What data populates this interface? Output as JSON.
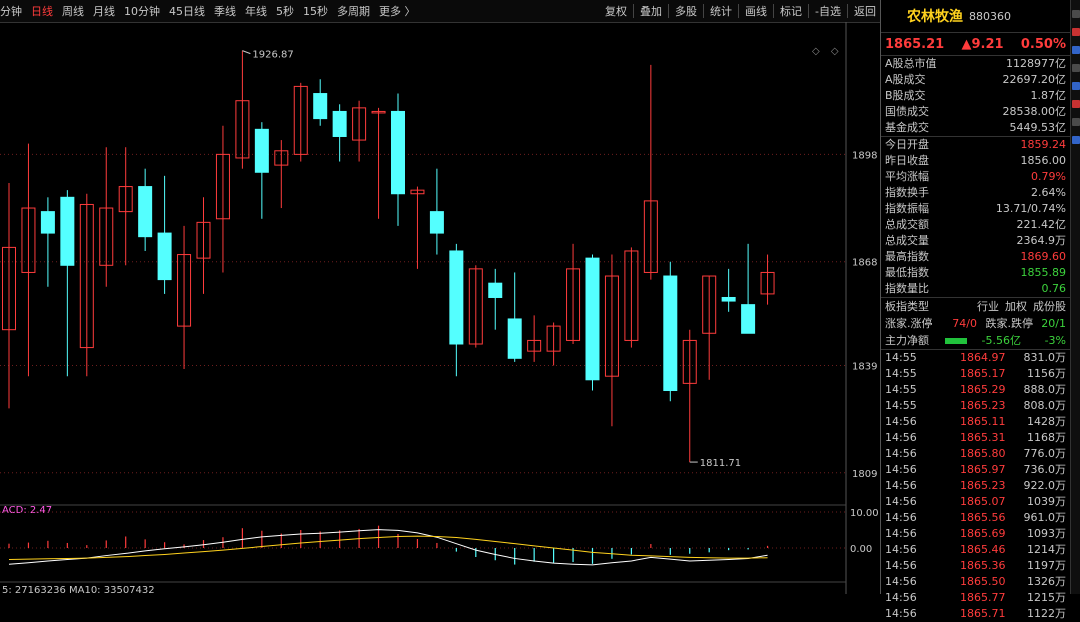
{
  "toolbar": {
    "periods": [
      "分钟",
      "日线",
      "周线",
      "月线",
      "10分钟",
      "45日线",
      "季线",
      "年线",
      "5秒",
      "15秒",
      "多周期",
      "更多 〉"
    ],
    "active": "日线",
    "actions": [
      "复权",
      "叠加",
      "多股",
      "统计",
      "画线",
      "标记",
      "-自选",
      "返回"
    ]
  },
  "chart": {
    "y_labels": [
      "1898",
      "1868",
      "1839",
      "1809"
    ],
    "high_label": "1926.87",
    "low_label": "1811.71",
    "macd_label": "ACD: 2.47",
    "macd_y_labels": [
      "10.00",
      "0.00"
    ],
    "volume_label": "5: 27163236  MA10: 33507432",
    "colors": {
      "up": "#ff3c3c",
      "down": "#54ffff",
      "grid": "#6e1e1e"
    }
  },
  "chart_data": {
    "type": "candlestick",
    "ylim": [
      1800,
      1935
    ],
    "candles": [
      {
        "o": 1849,
        "c": 1872,
        "h": 1890,
        "l": 1827
      },
      {
        "o": 1865,
        "c": 1883,
        "h": 1901,
        "l": 1836
      },
      {
        "o": 1882,
        "c": 1876,
        "h": 1886,
        "l": 1861
      },
      {
        "o": 1886,
        "c": 1867,
        "h": 1888,
        "l": 1836
      },
      {
        "o": 1844,
        "c": 1884,
        "h": 1887,
        "l": 1836
      },
      {
        "o": 1867,
        "c": 1883,
        "h": 1900,
        "l": 1861
      },
      {
        "o": 1882,
        "c": 1889,
        "h": 1900,
        "l": 1867
      },
      {
        "o": 1889,
        "c": 1875,
        "h": 1894,
        "l": 1871
      },
      {
        "o": 1876,
        "c": 1863,
        "h": 1892,
        "l": 1859
      },
      {
        "o": 1850,
        "c": 1870,
        "h": 1878,
        "l": 1838
      },
      {
        "o": 1869,
        "c": 1879,
        "h": 1886,
        "l": 1859
      },
      {
        "o": 1880,
        "c": 1898,
        "h": 1906,
        "l": 1865
      },
      {
        "o": 1897,
        "c": 1913,
        "h": 1927,
        "l": 1894
      },
      {
        "o": 1905,
        "c": 1893,
        "h": 1907,
        "l": 1880
      },
      {
        "o": 1895,
        "c": 1899,
        "h": 1902,
        "l": 1883
      },
      {
        "o": 1898,
        "c": 1917,
        "h": 1918,
        "l": 1896
      },
      {
        "o": 1915,
        "c": 1908,
        "h": 1919,
        "l": 1906
      },
      {
        "o": 1910,
        "c": 1903,
        "h": 1912,
        "l": 1896
      },
      {
        "o": 1902,
        "c": 1911,
        "h": 1913,
        "l": 1896
      },
      {
        "o": 1910,
        "c": 1910,
        "h": 1911,
        "l": 1880
      },
      {
        "o": 1910,
        "c": 1887,
        "h": 1915,
        "l": 1878
      },
      {
        "o": 1887,
        "c": 1888,
        "h": 1889,
        "l": 1866
      },
      {
        "o": 1882,
        "c": 1876,
        "h": 1894,
        "l": 1870
      },
      {
        "o": 1871,
        "c": 1845,
        "h": 1873,
        "l": 1836
      },
      {
        "o": 1845,
        "c": 1866,
        "h": 1867,
        "l": 1844
      },
      {
        "o": 1862,
        "c": 1858,
        "h": 1866,
        "l": 1849
      },
      {
        "o": 1852,
        "c": 1841,
        "h": 1865,
        "l": 1840
      },
      {
        "o": 1843,
        "c": 1846,
        "h": 1853,
        "l": 1840
      },
      {
        "o": 1843,
        "c": 1850,
        "h": 1851,
        "l": 1839
      },
      {
        "o": 1846,
        "c": 1866,
        "h": 1873,
        "l": 1845
      },
      {
        "o": 1869,
        "c": 1835,
        "h": 1870,
        "l": 1832
      },
      {
        "o": 1836,
        "c": 1864,
        "h": 1870,
        "l": 1822
      },
      {
        "o": 1846,
        "c": 1871,
        "h": 1872,
        "l": 1844
      },
      {
        "o": 1865,
        "c": 1885,
        "h": 1923,
        "l": 1863
      },
      {
        "o": 1864,
        "c": 1832,
        "h": 1868,
        "l": 1829
      },
      {
        "o": 1834,
        "c": 1846,
        "h": 1849,
        "l": 1812
      },
      {
        "o": 1848,
        "c": 1864,
        "h": 1864,
        "l": 1835
      },
      {
        "o": 1858,
        "c": 1857,
        "h": 1866,
        "l": 1854
      },
      {
        "o": 1856,
        "c": 1848,
        "h": 1873,
        "l": 1848
      },
      {
        "o": 1859,
        "c": 1865,
        "h": 1870,
        "l": 1856
      }
    ],
    "macd": [
      1.2,
      1.5,
      2.0,
      1.4,
      0.8,
      2.1,
      3.2,
      2.4,
      1.6,
      1.0,
      2.2,
      3.0,
      5.5,
      4.8,
      4.0,
      5.0,
      4.6,
      4.9,
      5.3,
      6.2,
      3.9,
      2.5,
      1.4,
      -1.0,
      -2.5,
      -3.4,
      -4.6,
      -3.8,
      -4.2,
      -3.9,
      -4.4,
      -3.0,
      -1.8,
      1.1,
      -1.9,
      -1.6,
      -1.2,
      -0.6,
      -0.4,
      0.6
    ],
    "dif": [
      -4.5,
      -4.1,
      -3.6,
      -3.2,
      -2.8,
      -2.1,
      -1.5,
      -0.8,
      -0.2,
      0.3,
      0.9,
      1.6,
      2.4,
      3.1,
      3.5,
      3.9,
      4.1,
      4.4,
      4.8,
      5.1,
      4.9,
      4.2,
      3.0,
      1.2,
      -0.6,
      -1.8,
      -2.9,
      -3.6,
      -4.2,
      -4.5,
      -4.7,
      -4.1,
      -3.6,
      -2.6,
      -3.1,
      -3.6,
      -3.4,
      -3.2,
      -2.9,
      -2.0
    ],
    "dea": [
      -3.2,
      -3.1,
      -3.0,
      -2.9,
      -2.8,
      -2.6,
      -2.4,
      -2.1,
      -1.8,
      -1.4,
      -1.0,
      -0.6,
      -0.1,
      0.4,
      0.9,
      1.4,
      1.8,
      2.2,
      2.6,
      2.9,
      3.2,
      3.3,
      3.2,
      2.9,
      2.4,
      1.8,
      1.2,
      0.6,
      0.0,
      -0.6,
      -1.2,
      -1.6,
      -2.0,
      -2.2,
      -2.4,
      -2.6,
      -2.7,
      -2.8,
      -2.8,
      -2.7
    ]
  },
  "panel": {
    "name": "农林牧渔",
    "code": "880360",
    "price": "1865.21",
    "change": "▲9.21",
    "pct": "0.50%",
    "market": [
      {
        "k": "A股总市值",
        "v": "1128977亿",
        "c": ""
      },
      {
        "k": "A股成交",
        "v": "22697.20亿",
        "c": ""
      },
      {
        "k": "B股成交",
        "v": "1.87亿",
        "c": ""
      },
      {
        "k": "国债成交",
        "v": "28538.00亿",
        "c": ""
      },
      {
        "k": "基金成交",
        "v": "5449.53亿",
        "c": ""
      }
    ],
    "stats": [
      {
        "k": "今日开盘",
        "v": "1859.24",
        "c": "red"
      },
      {
        "k": "昨日收盘",
        "v": "1856.00",
        "c": ""
      },
      {
        "k": "平均涨幅",
        "v": "0.79%",
        "c": "red"
      },
      {
        "k": "指数换手",
        "v": "2.64%",
        "c": ""
      },
      {
        "k": "指数振幅",
        "v": "13.71/0.74%",
        "c": ""
      },
      {
        "k": "总成交额",
        "v": "221.42亿",
        "c": ""
      },
      {
        "k": "总成交量",
        "v": "2364.9万",
        "c": ""
      },
      {
        "k": "最高指数",
        "v": "1869.60",
        "c": "red"
      },
      {
        "k": "最低指数",
        "v": "1855.89",
        "c": "green"
      },
      {
        "k": "指数量比",
        "v": "0.76",
        "c": "green"
      }
    ],
    "plate": {
      "type_label": "板指类型",
      "opts": [
        "行业",
        "加权",
        "成份股"
      ],
      "up_label": "涨家.涨停",
      "up_val": "74/0",
      "down_label": "跌家.跌停",
      "down_val": "20/1",
      "flow_label": "主力净额",
      "flow_val": "-5.56亿",
      "flow_pct": "-3%"
    },
    "ticks": [
      {
        "t": "14:55",
        "p": "1864.97",
        "q": "831.0万"
      },
      {
        "t": "14:55",
        "p": "1865.17",
        "q": "1156万"
      },
      {
        "t": "14:55",
        "p": "1865.29",
        "q": "888.0万"
      },
      {
        "t": "14:55",
        "p": "1865.23",
        "q": "808.0万"
      },
      {
        "t": "14:56",
        "p": "1865.11",
        "q": "1428万"
      },
      {
        "t": "14:56",
        "p": "1865.31",
        "q": "1168万"
      },
      {
        "t": "14:56",
        "p": "1865.80",
        "q": "776.0万"
      },
      {
        "t": "14:56",
        "p": "1865.97",
        "q": "736.0万"
      },
      {
        "t": "14:56",
        "p": "1865.23",
        "q": "922.0万"
      },
      {
        "t": "14:56",
        "p": "1865.07",
        "q": "1039万"
      },
      {
        "t": "14:56",
        "p": "1865.56",
        "q": "961.0万"
      },
      {
        "t": "14:56",
        "p": "1865.69",
        "q": "1093万"
      },
      {
        "t": "14:56",
        "p": "1865.46",
        "q": "1214万"
      },
      {
        "t": "14:56",
        "p": "1865.36",
        "q": "1197万"
      },
      {
        "t": "14:56",
        "p": "1865.50",
        "q": "1326万"
      },
      {
        "t": "14:56",
        "p": "1865.77",
        "q": "1215万"
      },
      {
        "t": "14:56",
        "p": "1865.71",
        "q": "1122万"
      }
    ]
  }
}
